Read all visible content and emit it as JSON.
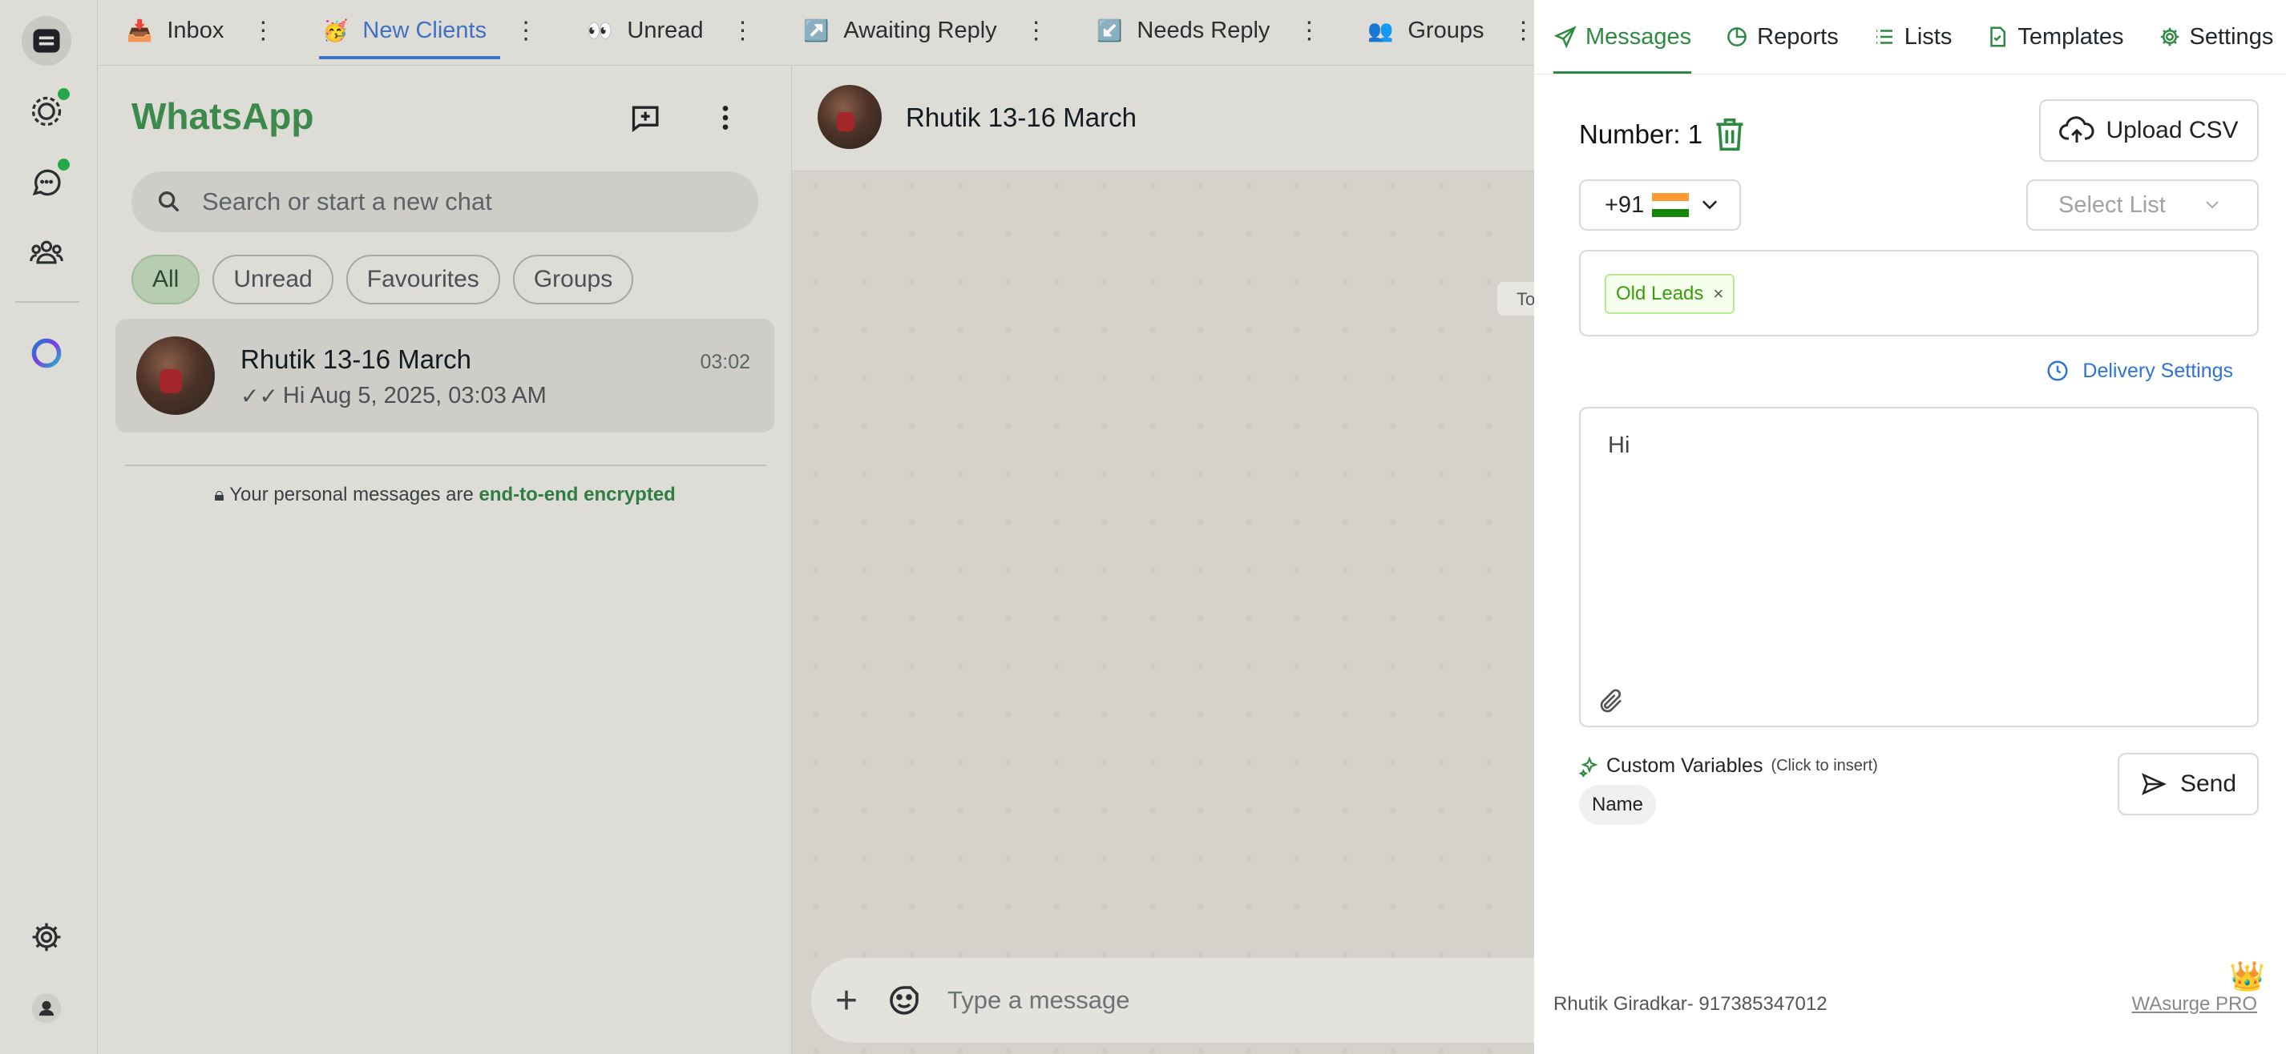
{
  "rail": {
    "icons": [
      "chats-icon",
      "status-icon",
      "channels-icon",
      "communities-icon",
      "meta-ai-icon",
      "settings-icon",
      "profile-icon"
    ]
  },
  "tabs": [
    {
      "emoji": "📥",
      "label": "Inbox",
      "active": false
    },
    {
      "emoji": "🥳",
      "label": "New Clients",
      "active": true
    },
    {
      "emoji": "👀",
      "label": "Unread",
      "active": false
    },
    {
      "emoji": "↗️",
      "label": "Awaiting Reply",
      "active": false
    },
    {
      "emoji": "↙️",
      "label": "Needs Reply",
      "active": false
    },
    {
      "emoji": "👥",
      "label": "Groups",
      "active": false
    }
  ],
  "chatlist": {
    "title": "WhatsApp",
    "search_placeholder": "Search or start a new chat",
    "filters": [
      "All",
      "Unread",
      "Favourites",
      "Groups"
    ],
    "selected_filter": "All",
    "chats": [
      {
        "name": "Rhutik 13-16 March",
        "time": "03:02",
        "ticks": "✓✓",
        "preview": "Hi Aug 5, 2025, 03:03 AM"
      }
    ],
    "encryption_prefix": "Your personal messages are ",
    "encryption_link": "end-to-end encrypted"
  },
  "conversation": {
    "contact_name": "Rhutik 13-16 March",
    "date_chip": "To",
    "composer_placeholder": "Type a message"
  },
  "panel": {
    "tabs": [
      {
        "label": "Messages",
        "icon": "send-icon",
        "active": true
      },
      {
        "label": "Reports",
        "icon": "pie-chart-icon",
        "active": false
      },
      {
        "label": "Lists",
        "icon": "list-icon",
        "active": false
      },
      {
        "label": "Templates",
        "icon": "file-check-icon",
        "active": false
      },
      {
        "label": "Settings",
        "icon": "gear-icon",
        "active": false
      }
    ],
    "number_label": "Number: 1",
    "upload_label": "Upload CSV",
    "country_code": "+91",
    "select_list_placeholder": "Select List",
    "tags": [
      "Old Leads"
    ],
    "tag_close": "×",
    "delivery_settings": "Delivery Settings",
    "message_text": "Hi",
    "custom_vars_label": "Custom Variables",
    "custom_vars_hint": "(Click to insert)",
    "variables": [
      "Name"
    ],
    "send_label": "Send",
    "footer_account": "Rhutik Giradkar- 917385347012",
    "footer_pro": "WAsurge PRO",
    "crown_emoji": "👑",
    "colors": {
      "accent": "#2e8a43",
      "link": "#2d74d6",
      "tag_text": "#389e0d"
    }
  }
}
